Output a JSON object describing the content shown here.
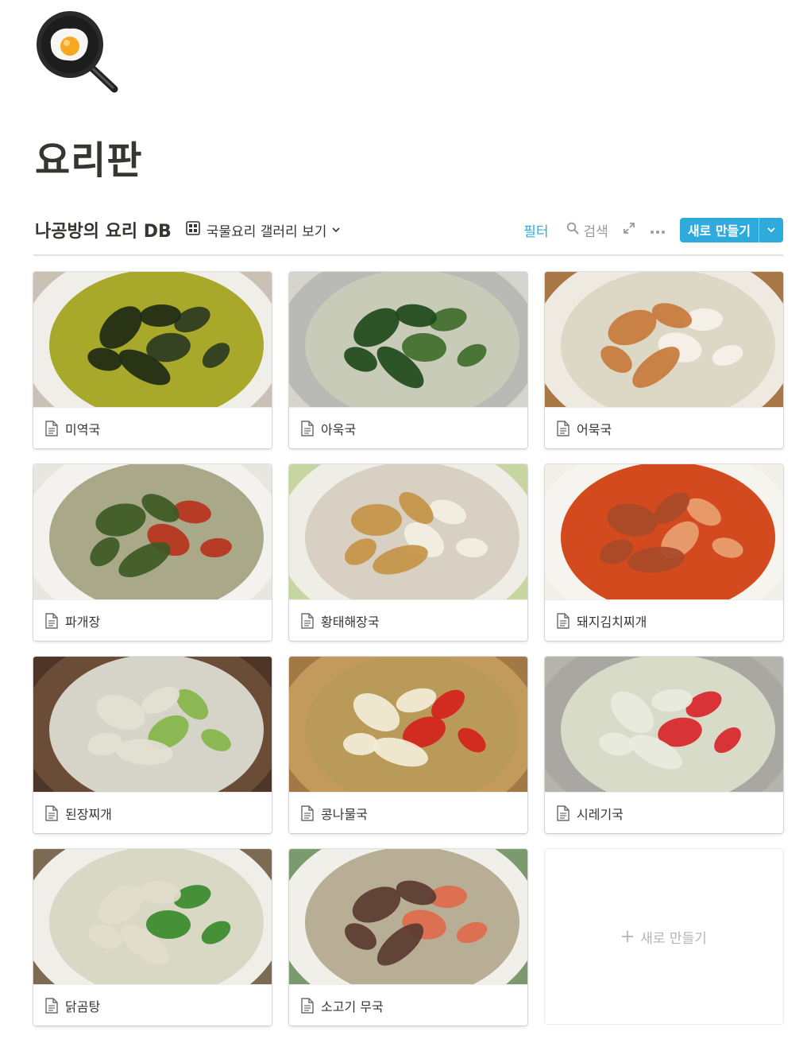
{
  "page": {
    "icon": "frying-pan-egg-icon",
    "title": "요리판"
  },
  "database": {
    "title": "나공방의 요리 DB",
    "view_icon": "gallery-grid-icon",
    "view_name": "국물요리 갤러리 보기",
    "filter_label": "필터",
    "search_label": "검색",
    "new_button_label": "새로 만들기"
  },
  "gallery": {
    "cards": [
      {
        "name": "미역국",
        "photo": "seaweed-soup-photo"
      },
      {
        "name": "아욱국",
        "photo": "mallow-soup-photo"
      },
      {
        "name": "어묵국",
        "photo": "fishcake-soup-photo"
      },
      {
        "name": "파개장",
        "photo": "green-onion-spicy-soup-photo"
      },
      {
        "name": "황태해장국",
        "photo": "dried-pollack-soup-photo"
      },
      {
        "name": "돼지김치찌개",
        "photo": "pork-kimchi-stew-photo"
      },
      {
        "name": "된장찌개",
        "photo": "soybean-paste-stew-photo"
      },
      {
        "name": "콩나물국",
        "photo": "bean-sprout-soup-photo"
      },
      {
        "name": "시레기국",
        "photo": "dried-radish-greens-soup-photo"
      },
      {
        "name": "닭곰탕",
        "photo": "chicken-soup-photo"
      },
      {
        "name": "소고기 무국",
        "photo": "beef-radish-soup-photo"
      }
    ],
    "new_card_label": "새로 만들기"
  },
  "colors": {
    "accent": "#2eaadc",
    "text": "#37352f",
    "muted": "#9b9a97"
  }
}
